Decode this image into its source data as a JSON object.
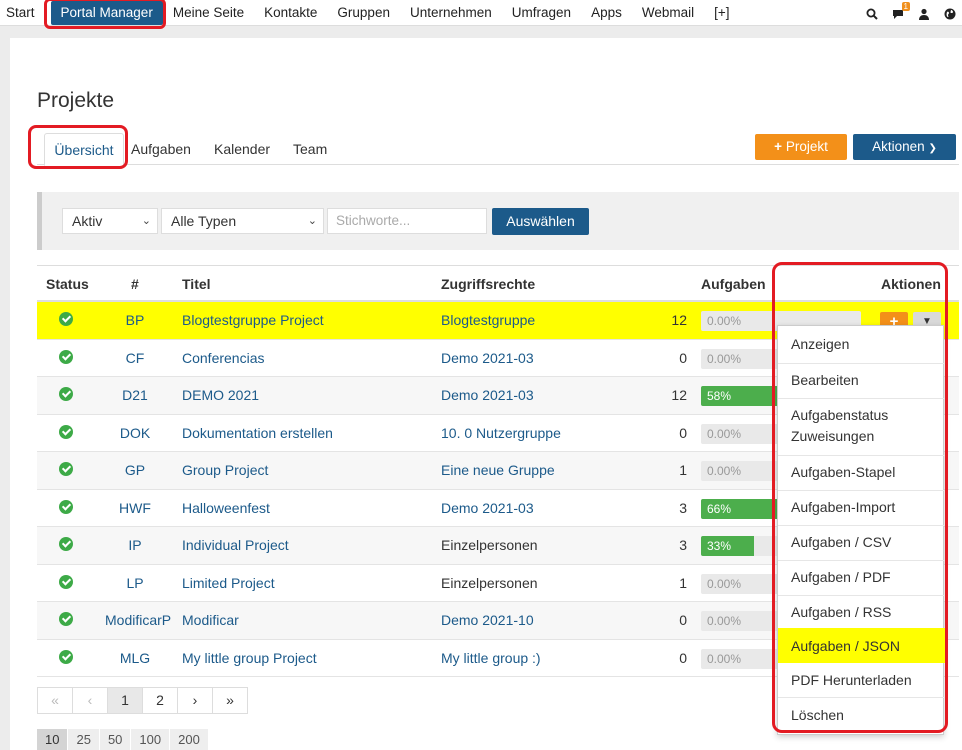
{
  "nav": {
    "items": [
      "Start",
      "Portal Manager",
      "Meine Seite",
      "Kontakte",
      "Gruppen",
      "Unternehmen",
      "Umfragen",
      "Apps",
      "Webmail",
      "[+]"
    ],
    "badge": "1"
  },
  "page": {
    "title": "Projekte",
    "tabs": [
      "Übersicht",
      "Aufgaben",
      "Kalender",
      "Team"
    ],
    "btn_projekt": "Projekt",
    "btn_aktionen": "Aktionen"
  },
  "filter": {
    "status": "Aktiv",
    "type": "Alle Typen",
    "keywords_placeholder": "Stichworte...",
    "submit": "Auswählen"
  },
  "table": {
    "headers": {
      "status": "Status",
      "id": "#",
      "title": "Titel",
      "access": "Zugriffsrechte",
      "tasks": "Aufgaben",
      "actions": "Aktionen"
    },
    "rows": [
      {
        "code": "BP",
        "title": "Blogtestgruppe Project",
        "access": "Blogtestgruppe",
        "access_link": true,
        "tasks": "12",
        "progress_label": "0.00%",
        "progress": 0
      },
      {
        "code": "CF",
        "title": "Conferencias",
        "access": "Demo 2021-03",
        "access_link": true,
        "tasks": "0",
        "progress_label": "0.00%",
        "progress": 0
      },
      {
        "code": "D21",
        "title": "DEMO 2021",
        "access": "Demo 2021-03",
        "access_link": true,
        "tasks": "12",
        "progress_label": "58%",
        "progress": 58
      },
      {
        "code": "DOK",
        "title": "Dokumentation erstellen",
        "access": "10. 0 Nutzergruppe",
        "access_link": true,
        "tasks": "0",
        "progress_label": "0.00%",
        "progress": 0
      },
      {
        "code": "GP",
        "title": "Group Project",
        "access": "Eine neue Gruppe",
        "access_link": true,
        "tasks": "1",
        "progress_label": "0.00%",
        "progress": 0
      },
      {
        "code": "HWF",
        "title": "Halloweenfest",
        "access": "Demo 2021-03",
        "access_link": true,
        "tasks": "3",
        "progress_label": "66%",
        "progress": 66
      },
      {
        "code": "IP",
        "title": "Individual Project",
        "access": "Einzelpersonen",
        "access_link": false,
        "tasks": "3",
        "progress_label": "33%",
        "progress": 33
      },
      {
        "code": "LP",
        "title": "Limited Project",
        "access": "Einzelpersonen",
        "access_link": false,
        "tasks": "1",
        "progress_label": "0.00%",
        "progress": 0
      },
      {
        "code": "ModificarP",
        "title": "Modificar",
        "access": "Demo 2021-10",
        "access_link": true,
        "tasks": "0",
        "progress_label": "0.00%",
        "progress": 0
      },
      {
        "code": "MLG",
        "title": "My little group Project",
        "access": "My little group :)",
        "access_link": true,
        "tasks": "0",
        "progress_label": "0.00%",
        "progress": 0
      }
    ]
  },
  "actions_menu": {
    "items": [
      "Anzeigen",
      "Bearbeiten",
      "Aufgabenstatus Zuweisungen",
      "Aufgaben-Stapel",
      "Aufgaben-Import",
      "Aufgaben / CSV",
      "Aufgaben / PDF",
      "Aufgaben / RSS",
      "Aufgaben / JSON",
      "PDF Herunterladen",
      "Löschen"
    ],
    "selected": "Aufgaben / JSON"
  },
  "pagination": {
    "pages": [
      "«",
      "‹",
      "1",
      "2",
      "›",
      "»"
    ],
    "current": "1",
    "per_page": [
      "10",
      "25",
      "50",
      "100",
      "200"
    ],
    "per_page_current": "10"
  }
}
